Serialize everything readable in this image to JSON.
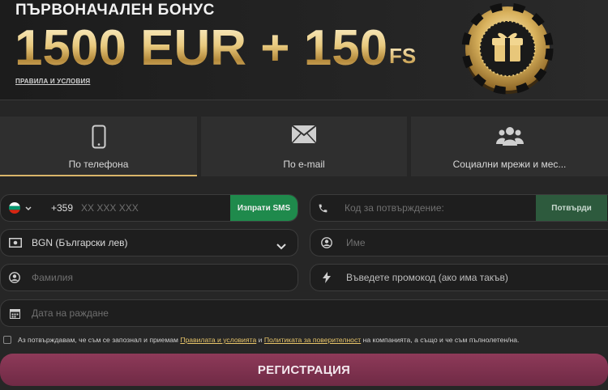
{
  "banner": {
    "title": "ПЪРВОНАЧАЛЕН БОНУС",
    "amount": "1500 EUR + 150",
    "suffix": "FS",
    "terms_link": "ПРАВИЛА И УСЛОВИЯ"
  },
  "tabs": [
    {
      "label": "По телефона",
      "icon": "smartphone-icon",
      "active": true
    },
    {
      "label": "По e-mail",
      "icon": "envelope-icon",
      "active": false
    },
    {
      "label": "Социални мрежи и мес...",
      "icon": "users-icon",
      "active": false
    }
  ],
  "form": {
    "phone": {
      "country_flag": "bulgaria-flag-icon",
      "code": "+359",
      "placeholder": "XX XXX XXX",
      "button": "Изпрати SMS"
    },
    "confirm_code": {
      "placeholder": "Код за потвърждение:",
      "button": "Потвърди"
    },
    "currency": {
      "value": "BGN (Български лев)"
    },
    "first_name": {
      "placeholder": "Име"
    },
    "last_name": {
      "placeholder": "Фамилия"
    },
    "promo": {
      "placeholder": "Въведете промокод (ако има такъв)"
    },
    "birth_date": {
      "placeholder": "Дата на раждане"
    }
  },
  "consent": {
    "text_before": "Аз потвърждавам, че съм се запознал и приемам",
    "link_terms": "Правилата и условията",
    "and": "и",
    "link_privacy": "Политиката за поверителност",
    "text_after": "на компанията, а също и че съм пълнолетен/на."
  },
  "register_button": "РЕГИСТРАЦИЯ",
  "colors": {
    "accent_gold": "#d9b56a",
    "green_button": "#1f8a4c",
    "dark_green_button": "#2d5a3d",
    "register_button": "#7e3250",
    "link": "#e8c56a"
  }
}
